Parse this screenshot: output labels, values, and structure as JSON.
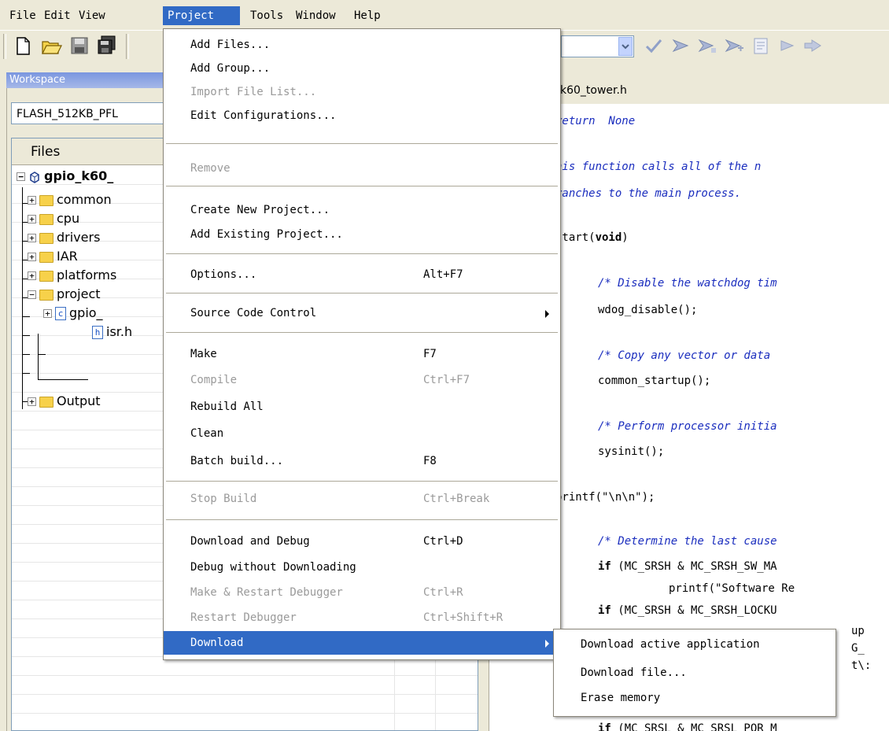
{
  "menubar": {
    "items": [
      {
        "label": "File"
      },
      {
        "label": "Edit"
      },
      {
        "label": "View"
      },
      {
        "label": "Project"
      },
      {
        "label": "Tools"
      },
      {
        "label": "Window"
      },
      {
        "label": "Help"
      }
    ]
  },
  "workspace": {
    "title": "Workspace",
    "configuration": "FLASH_512KB_PFL",
    "files_header": "Files",
    "tree": [
      {
        "label": "gpio_k60_"
      },
      {
        "label": "common"
      },
      {
        "label": "cpu"
      },
      {
        "label": "drivers"
      },
      {
        "label": "IAR"
      },
      {
        "label": "platforms"
      },
      {
        "label": "project"
      },
      {
        "label": "gpio_"
      },
      {
        "label": "isr.h"
      },
      {
        "label": "Output"
      }
    ]
  },
  "editor": {
    "tab_label": "k60_tower.h",
    "lines": [
      "return  None",
      "his function calls all of the n",
      "ranches to the main process.",
      " start(void)",
      "/* Disable the watchdog tim",
      "wdog_disable();",
      "/* Copy any vector or data",
      "common_startup();",
      "/* Perform processor initia",
      "sysinit();",
      "printf(\"\\n\\n\");",
      "/* Determine the last cause",
      "if (MC_SRSH & MC_SRSH_SW_MA",
      "printf(\"Software Re",
      "if (MC_SRSH & MC_SRSH_LOCKU",
      "up",
      "G_",
      "t\\:",
      "if (MC_SRSL & MC_SRSL_POR_M"
    ]
  },
  "project_menu": {
    "items": [
      {
        "label": "Add Files...",
        "shortcut": ""
      },
      {
        "label": "Add Group...",
        "shortcut": ""
      },
      {
        "label": "Import File List...",
        "shortcut": ""
      },
      {
        "label": "Edit Configurations...",
        "shortcut": ""
      },
      {
        "label": "Remove",
        "shortcut": ""
      },
      {
        "label": "Create New Project...",
        "shortcut": ""
      },
      {
        "label": "Add Existing Project...",
        "shortcut": ""
      },
      {
        "label": "Options...",
        "shortcut": "Alt+F7"
      },
      {
        "label": "Source Code Control",
        "shortcut": ""
      },
      {
        "label": "Make",
        "shortcut": "F7"
      },
      {
        "label": "Compile",
        "shortcut": "Ctrl+F7"
      },
      {
        "label": "Rebuild All",
        "shortcut": ""
      },
      {
        "label": "Clean",
        "shortcut": ""
      },
      {
        "label": "Batch build...",
        "shortcut": "F8"
      },
      {
        "label": "Stop Build",
        "shortcut": "Ctrl+Break"
      },
      {
        "label": "Download and Debug",
        "shortcut": "Ctrl+D"
      },
      {
        "label": "Debug without Downloading",
        "shortcut": ""
      },
      {
        "label": "Make & Restart Debugger",
        "shortcut": "Ctrl+R"
      },
      {
        "label": "Restart Debugger",
        "shortcut": "Ctrl+Shift+R"
      },
      {
        "label": "Download",
        "shortcut": ""
      }
    ]
  },
  "download_submenu": {
    "items": [
      {
        "label": "Download active application"
      },
      {
        "label": "Download file..."
      },
      {
        "label": "Erase memory"
      }
    ]
  }
}
